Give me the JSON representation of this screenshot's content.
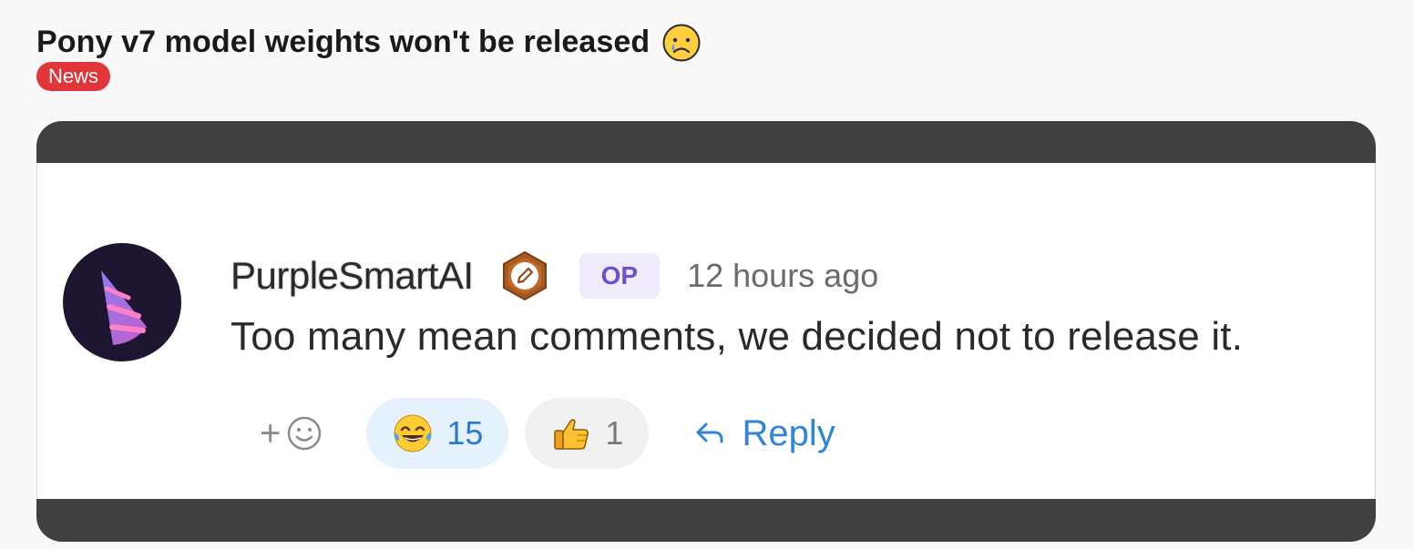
{
  "post": {
    "title": "Pony v7 model weights won't be released",
    "title_emoji": "crying-face-icon",
    "tag": "News",
    "tag_color": "#e0363a"
  },
  "comment": {
    "username": "PurpleSmartAI",
    "badge_icon": "pencil-hexagon-badge-icon",
    "op_label": "OP",
    "timestamp": "12 hours ago",
    "text": "Too many mean comments, we decided not to release it.",
    "add_reaction_icon": "add-emoji-icon",
    "reactions": [
      {
        "emoji": "tears-of-joy-icon",
        "count": "15",
        "active": true
      },
      {
        "emoji": "thumbs-up-icon",
        "count": "1",
        "active": false
      }
    ],
    "reply_label": "Reply",
    "accent_color": "#2f86d6"
  }
}
